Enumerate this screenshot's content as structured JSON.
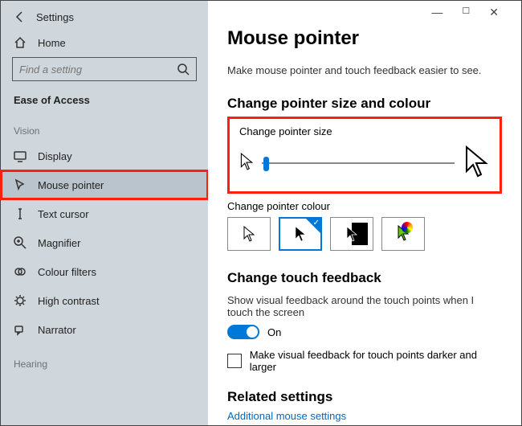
{
  "window": {
    "app_title": "Settings"
  },
  "sidebar": {
    "home": "Home",
    "search_placeholder": "Find a setting",
    "section": "Ease of Access",
    "groups": [
      {
        "label": "Vision",
        "items": [
          "Display",
          "Mouse pointer",
          "Text cursor",
          "Magnifier",
          "Colour filters",
          "High contrast",
          "Narrator"
        ],
        "selected_index": 1
      },
      {
        "label": "Hearing",
        "items": []
      }
    ]
  },
  "content": {
    "title": "Mouse pointer",
    "intro": "Make mouse pointer and touch feedback easier to see.",
    "section1": {
      "heading": "Change pointer size and colour",
      "size_label": "Change pointer size",
      "colour_label": "Change pointer colour",
      "colour_options": [
        "white",
        "black",
        "inverted",
        "custom"
      ],
      "colour_selected": 1
    },
    "section2": {
      "heading": "Change touch feedback",
      "toggle_text": "Show visual feedback around the touch points when I touch the screen",
      "toggle_state": "On",
      "checkbox_text": "Make visual feedback for touch points darker and larger"
    },
    "section3": {
      "heading": "Related settings",
      "link": "Additional mouse settings"
    }
  }
}
